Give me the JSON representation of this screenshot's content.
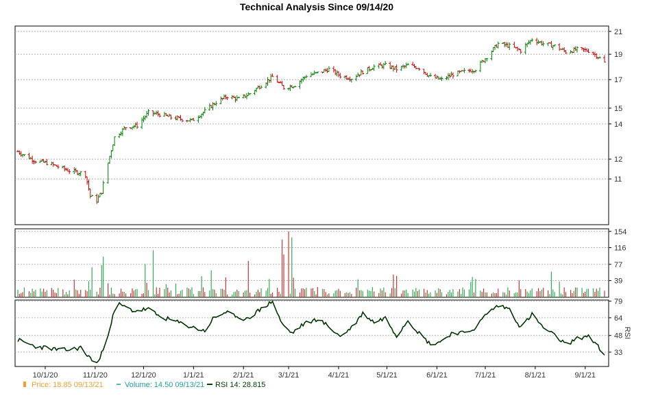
{
  "chart_data": {
    "type": "candlestick",
    "title": "Technical Analysis Since 09/14/20",
    "price_axis": {
      "ticks": [
        "21",
        "19",
        "17",
        "15",
        "14",
        "12",
        "11"
      ],
      "ylim": [
        9.0,
        21.5
      ],
      "scale": "log"
    },
    "volume_axis": {
      "ticks": [
        "154",
        "116",
        "77",
        "39"
      ],
      "ylim": [
        0,
        160
      ]
    },
    "rsi_axis": {
      "label": "RSI",
      "ticks": [
        "79",
        "64",
        "48",
        "33"
      ],
      "ylim": [
        20,
        80
      ]
    },
    "x_axis": {
      "ticks": [
        "10/1/20",
        "11/1/20",
        "12/1/20",
        "1/1/21",
        "2/1/21",
        "3/1/21",
        "4/1/21",
        "5/1/21",
        "6/1/21",
        "7/1/21",
        "8/1/21",
        "9/1/21"
      ]
    },
    "price_anchors": [
      [
        "2020-09-14",
        12.4
      ],
      [
        "2020-09-18",
        12.2
      ],
      [
        "2020-09-25",
        11.9
      ],
      [
        "2020-10-02",
        11.8
      ],
      [
        "2020-10-09",
        11.6
      ],
      [
        "2020-10-16",
        11.4
      ],
      [
        "2020-10-23",
        11.3
      ],
      [
        "2020-10-26",
        11.2
      ],
      [
        "2020-10-29",
        10.2
      ],
      [
        "2020-11-02",
        10.0
      ],
      [
        "2020-11-05",
        10.4
      ],
      [
        "2020-11-09",
        11.8
      ],
      [
        "2020-11-13",
        13.2
      ],
      [
        "2020-11-20",
        13.8
      ],
      [
        "2020-11-27",
        13.9
      ],
      [
        "2020-12-04",
        14.7
      ],
      [
        "2020-12-11",
        14.6
      ],
      [
        "2020-12-18",
        14.4
      ],
      [
        "2020-12-31",
        14.2
      ],
      [
        "2021-01-08",
        14.8
      ],
      [
        "2021-01-15",
        15.4
      ],
      [
        "2021-01-22",
        15.8
      ],
      [
        "2021-01-29",
        15.6
      ],
      [
        "2021-02-05",
        16.0
      ],
      [
        "2021-02-12",
        16.6
      ],
      [
        "2021-02-19",
        17.2
      ],
      [
        "2021-02-26",
        16.4
      ],
      [
        "2021-03-05",
        16.6
      ],
      [
        "2021-03-12",
        17.3
      ],
      [
        "2021-03-19",
        17.5
      ],
      [
        "2021-03-26",
        17.8
      ],
      [
        "2021-04-02",
        17.3
      ],
      [
        "2021-04-09",
        17.1
      ],
      [
        "2021-04-16",
        17.6
      ],
      [
        "2021-04-23",
        18.0
      ],
      [
        "2021-04-30",
        18.1
      ],
      [
        "2021-05-07",
        17.8
      ],
      [
        "2021-05-14",
        18.1
      ],
      [
        "2021-05-21",
        17.9
      ],
      [
        "2021-05-28",
        17.2
      ],
      [
        "2021-06-04",
        17.0
      ],
      [
        "2021-06-11",
        17.4
      ],
      [
        "2021-06-18",
        17.6
      ],
      [
        "2021-06-25",
        17.8
      ],
      [
        "2021-07-02",
        18.8
      ],
      [
        "2021-07-09",
        19.9
      ],
      [
        "2021-07-16",
        19.7
      ],
      [
        "2021-07-23",
        19.3
      ],
      [
        "2021-07-30",
        20.3
      ],
      [
        "2021-08-06",
        19.9
      ],
      [
        "2021-08-13",
        19.7
      ],
      [
        "2021-08-20",
        19.2
      ],
      [
        "2021-08-27",
        19.4
      ],
      [
        "2021-09-03",
        19.3
      ],
      [
        "2021-09-08",
        18.9
      ],
      [
        "2021-09-13",
        18.3
      ]
    ],
    "volume_spikes": [
      [
        "2020-10-30",
        70
      ],
      [
        "2020-11-05",
        75
      ],
      [
        "2020-11-06",
        95
      ],
      [
        "2020-12-02",
        78
      ],
      [
        "2020-12-07",
        110
      ],
      [
        "2021-02-04",
        85
      ],
      [
        "2021-02-25",
        135
      ],
      [
        "2021-02-26",
        100
      ],
      [
        "2021-03-01",
        154
      ],
      [
        "2021-03-03",
        140
      ]
    ],
    "rsi_anchors": [
      [
        "2020-09-14",
        44
      ],
      [
        "2020-09-25",
        38
      ],
      [
        "2020-10-02",
        37
      ],
      [
        "2020-10-09",
        35
      ],
      [
        "2020-10-16",
        35
      ],
      [
        "2020-10-23",
        37
      ],
      [
        "2020-10-27",
        30
      ],
      [
        "2020-11-02",
        23
      ],
      [
        "2020-11-04",
        27
      ],
      [
        "2020-11-09",
        50
      ],
      [
        "2020-11-13",
        70
      ],
      [
        "2020-11-16",
        76
      ],
      [
        "2020-11-25",
        70
      ],
      [
        "2020-12-04",
        72
      ],
      [
        "2020-12-11",
        65
      ],
      [
        "2020-12-18",
        62
      ],
      [
        "2021-01-01",
        55
      ],
      [
        "2021-01-08",
        52
      ],
      [
        "2021-01-13",
        63
      ],
      [
        "2021-01-22",
        70
      ],
      [
        "2021-01-29",
        62
      ],
      [
        "2021-02-05",
        65
      ],
      [
        "2021-02-12",
        72
      ],
      [
        "2021-02-19",
        79
      ],
      [
        "2021-02-25",
        58
      ],
      [
        "2021-03-03",
        50
      ],
      [
        "2021-03-10",
        58
      ],
      [
        "2021-03-19",
        63
      ],
      [
        "2021-03-26",
        56
      ],
      [
        "2021-04-02",
        47
      ],
      [
        "2021-04-09",
        55
      ],
      [
        "2021-04-16",
        68
      ],
      [
        "2021-04-23",
        60
      ],
      [
        "2021-04-30",
        64
      ],
      [
        "2021-05-07",
        48
      ],
      [
        "2021-05-14",
        62
      ],
      [
        "2021-05-21",
        50
      ],
      [
        "2021-05-28",
        40
      ],
      [
        "2021-06-04",
        43
      ],
      [
        "2021-06-11",
        51
      ],
      [
        "2021-06-18",
        50
      ],
      [
        "2021-06-25",
        55
      ],
      [
        "2021-07-02",
        68
      ],
      [
        "2021-07-09",
        75
      ],
      [
        "2021-07-16",
        72
      ],
      [
        "2021-07-23",
        55
      ],
      [
        "2021-07-30",
        67
      ],
      [
        "2021-08-06",
        55
      ],
      [
        "2021-08-13",
        48
      ],
      [
        "2021-08-20",
        40
      ],
      [
        "2021-08-27",
        45
      ],
      [
        "2021-09-03",
        48
      ],
      [
        "2021-09-08",
        40
      ],
      [
        "2021-09-13",
        29
      ]
    ],
    "legend": [
      {
        "label": "Price: 18.85  09/13/21",
        "color": "#f0a030",
        "swatch": "bar"
      },
      {
        "label": "Volume: 14.50  09/13/21",
        "color": "#20a0a0",
        "swatch": "dash"
      },
      {
        "label": "RSI 14: 28.815",
        "color": "#004000",
        "swatch": "line"
      }
    ],
    "colors": {
      "up": "#008000",
      "down": "#cc0000",
      "rsi": "#003300",
      "grid": "#a0a0a0"
    }
  }
}
